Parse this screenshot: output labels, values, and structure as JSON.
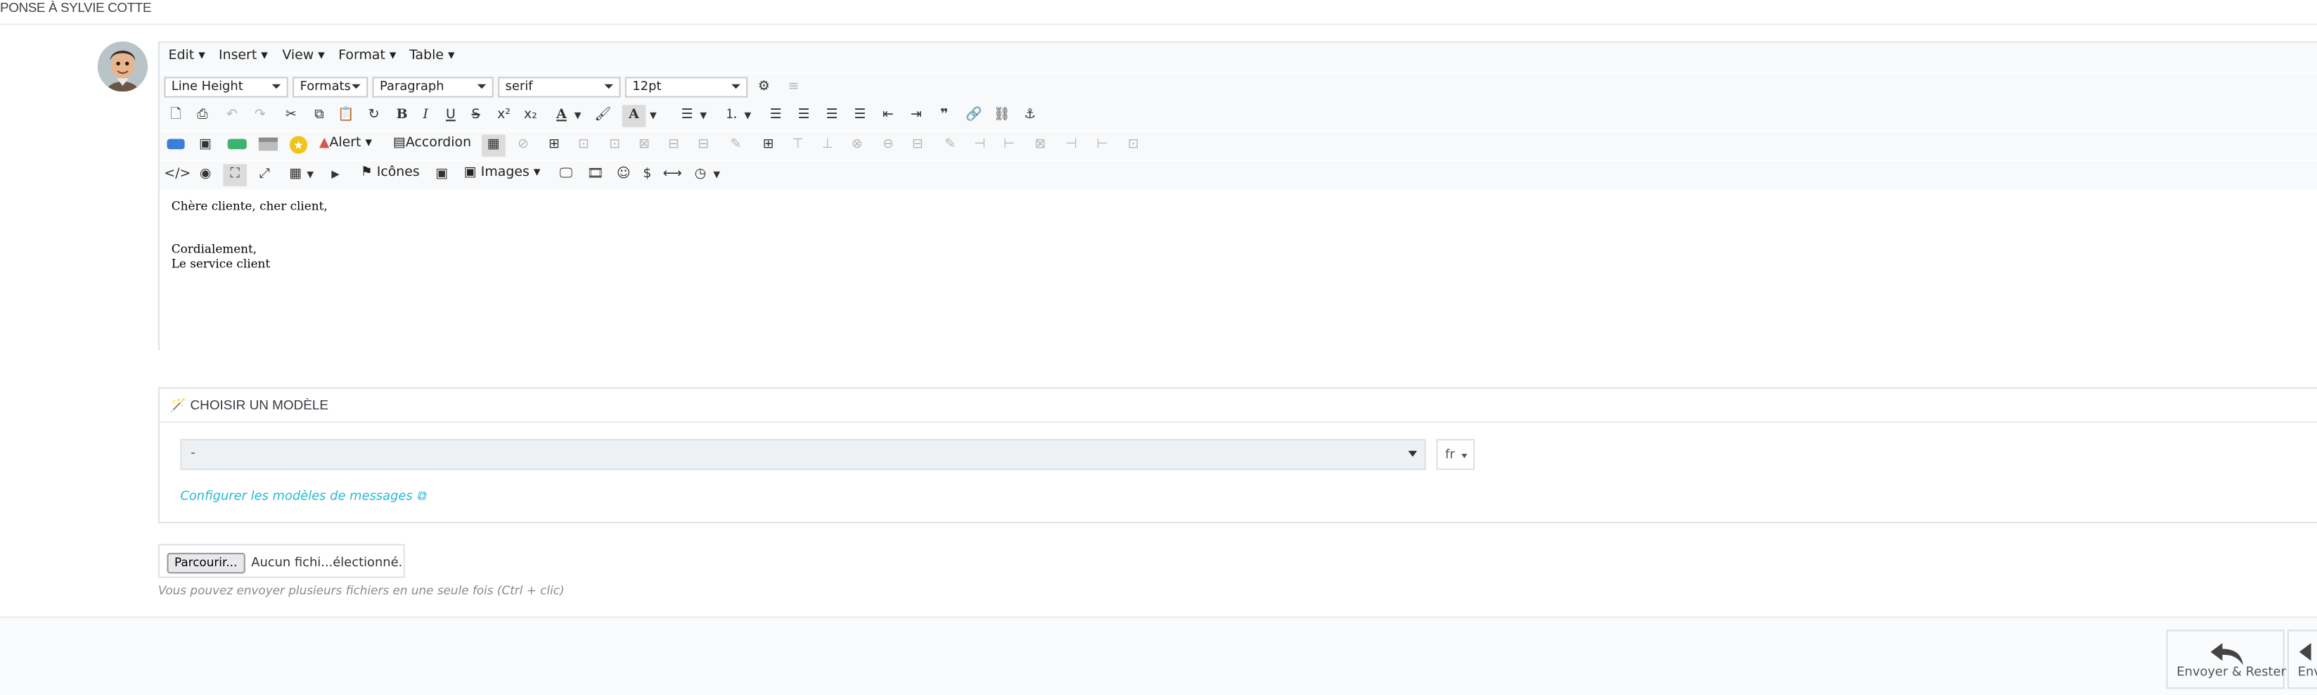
{
  "panel": {
    "title": "PONSE À SYLVIE COTTE"
  },
  "editor": {
    "menu": [
      "Edit",
      "Insert",
      "View",
      "Format",
      "Table"
    ],
    "selects": {
      "line_height": "Line Height",
      "formats": "Formats",
      "block": "Paragraph",
      "font_family": "serif",
      "font_size": "12pt"
    },
    "labels": {
      "alert": "Alert",
      "accordion": "Accordion",
      "icones": "Icônes",
      "images": "Images"
    },
    "content": {
      "line1": "Chère cliente, cher client,",
      "line2": "Cordialement,",
      "line3": "Le service client"
    }
  },
  "template": {
    "title": "CHOISIR UN MODÈLE",
    "select_value": "-",
    "lang": "fr",
    "config_link": "Configurer les modèles de messages"
  },
  "upload": {
    "browse_label": "Parcourir...",
    "file_status": "Aucun fichi...électionné.",
    "hint": "Vous pouvez envoyer plusieurs fichiers en une seule fois (Ctrl + clic)"
  },
  "footer": {
    "send_stay": "Envoyer & Rester",
    "send_truncated": "Env"
  },
  "colors": {
    "link": "#25b9d7",
    "toolbar_bg": "#f8f9fa",
    "border": "#dfe3e6",
    "alert_red": "#d9534f"
  }
}
